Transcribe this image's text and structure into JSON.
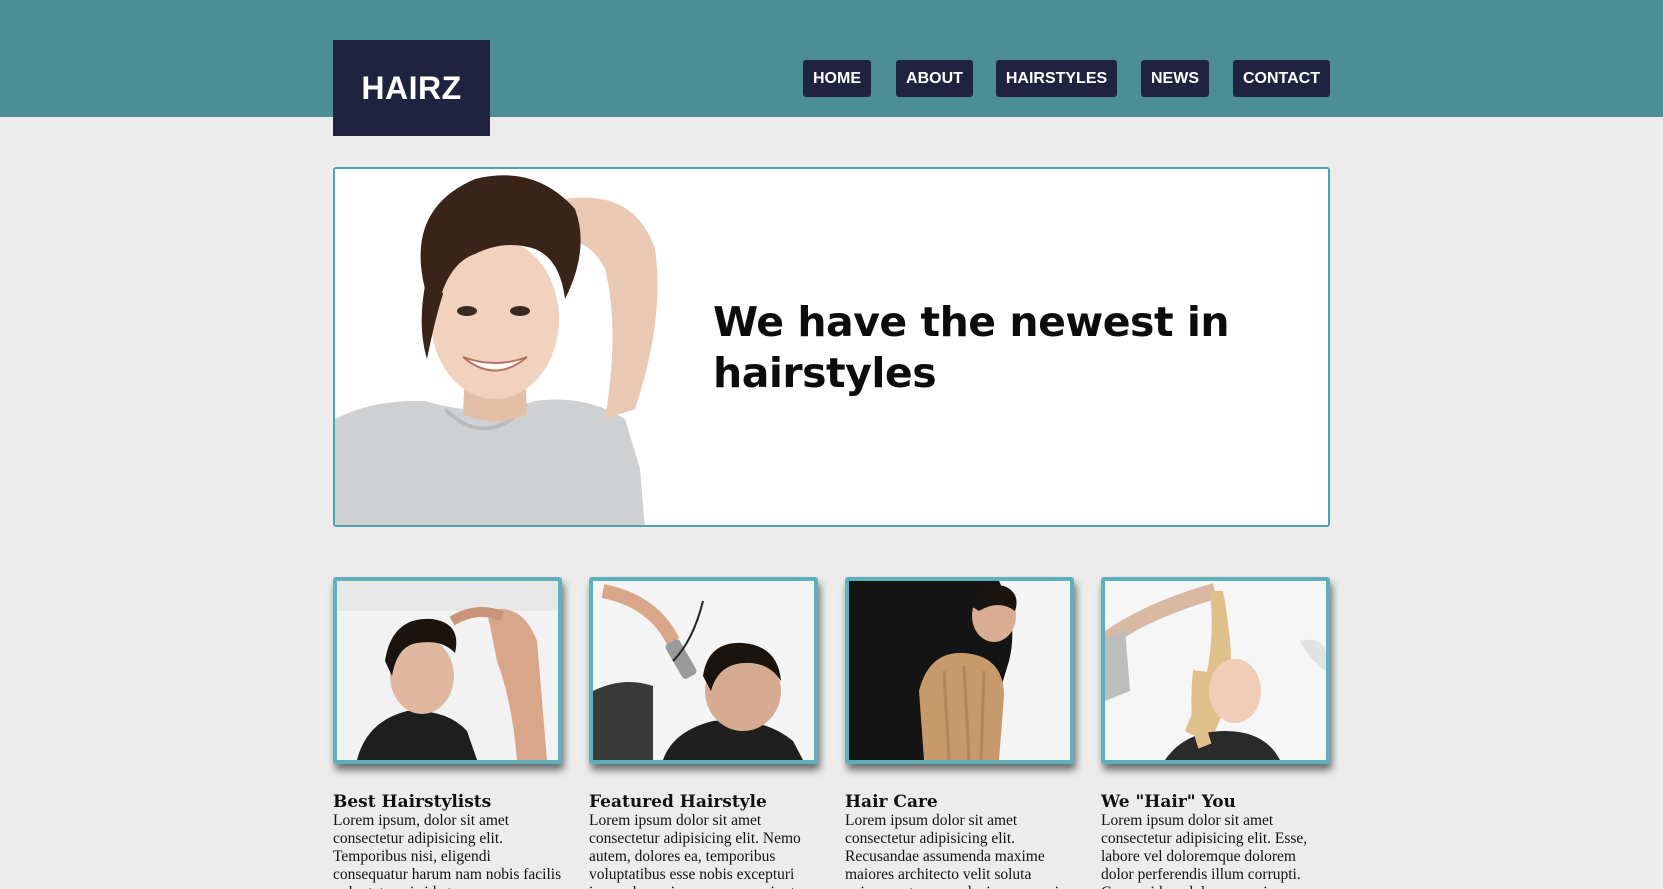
{
  "header": {
    "logo": "HAIRZ",
    "nav": [
      {
        "label": "HOME"
      },
      {
        "label": "ABOUT"
      },
      {
        "label": "HAIRSTYLES"
      },
      {
        "label": "NEWS"
      },
      {
        "label": "CONTACT"
      }
    ]
  },
  "hero": {
    "headline": "We have the newest in hairstyles"
  },
  "cards": [
    {
      "title": "Best Hairstylists",
      "text": "Lorem ipsum, dolor sit amet consectetur adipisicing elit. Temporibus nisi, eligendi consequatur harum nam nobis facilis voluptate quis id at."
    },
    {
      "title": "Featured Hairstyle",
      "text": "Lorem ipsum dolor sit amet consectetur adipisicing elit. Nemo autem, dolores ea, temporibus voluptatibus esse nobis excepturi ipsa culpa quia magnam nesciunt."
    },
    {
      "title": "Hair Care",
      "text": "Lorem ipsum dolor sit amet consectetur adipisicing elit. Recusandae assumenda maxime maiores architecto velit soluta quisquam tempora ducimus magni."
    },
    {
      "title": "We \"Hair\" You",
      "text": "Lorem ipsum dolor sit amet consectetur adipisicing elit. Esse, labore vel doloremque dolorem dolor perferendis illum corrupti. Cum quidem dolores quasi."
    }
  ],
  "colors": {
    "header_bg": "#4d8d96",
    "logo_bg": "#1f2340",
    "accent_border": "#4fa3ae",
    "page_bg": "#ececec"
  }
}
